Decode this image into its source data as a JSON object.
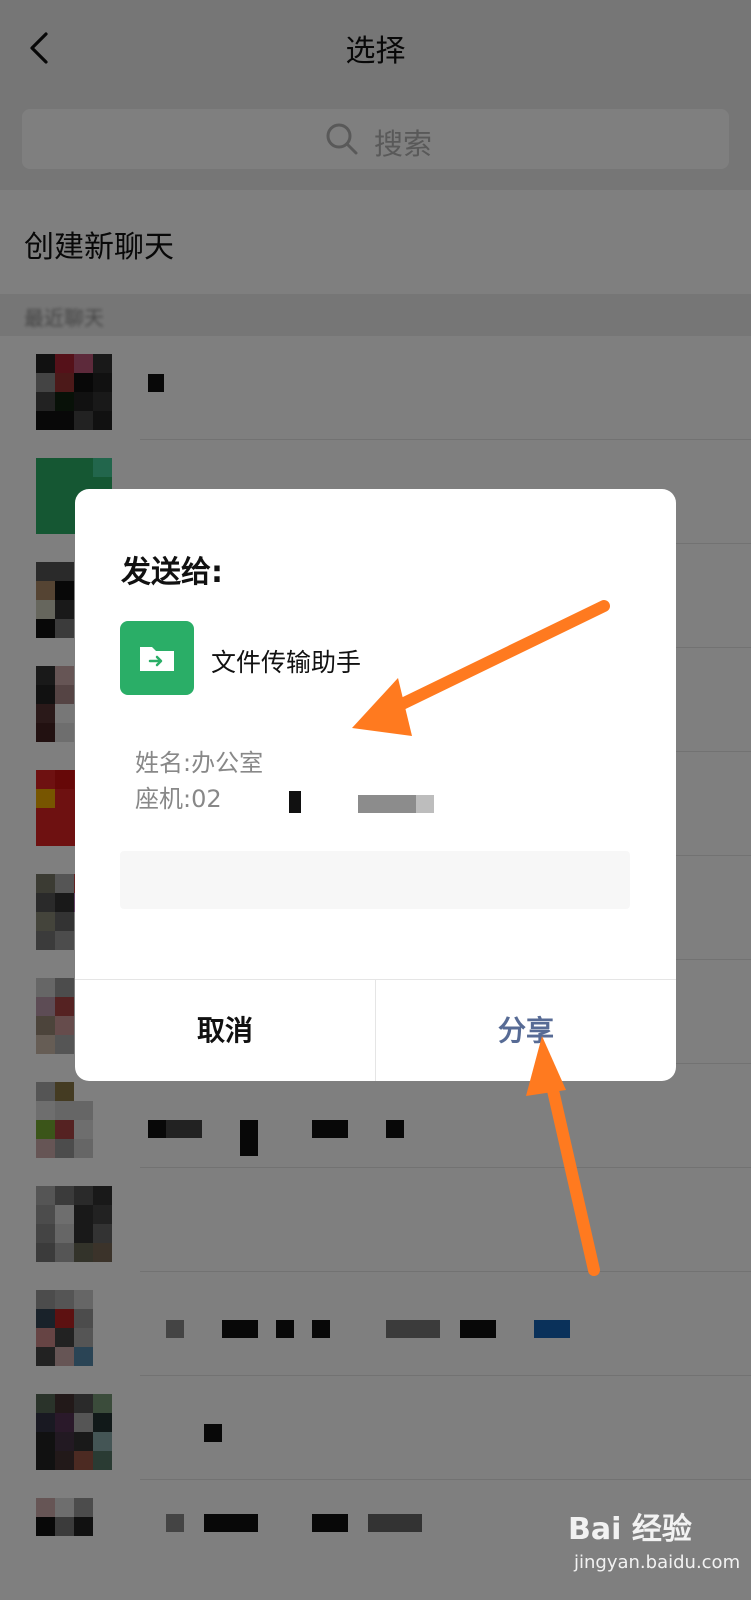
{
  "header": {
    "title": "选择"
  },
  "search": {
    "placeholder": "搜索"
  },
  "new_chat": {
    "label": "创建新聊天"
  },
  "section": {
    "label": "最近聊天"
  },
  "dialog": {
    "heading": "发送给:",
    "recipient": "文件传输助手",
    "contact_name": "姓名:办公室",
    "contact_phone": "座机:02",
    "cancel_label": "取消",
    "share_label": "分享"
  },
  "watermark": {
    "brand": "Bai 经验",
    "domain": "jingyan.baidu.com"
  },
  "colors": {
    "accent_green": "#2aae67",
    "share_blue": "#576b95",
    "arrow_orange": "#ff7a1f"
  }
}
